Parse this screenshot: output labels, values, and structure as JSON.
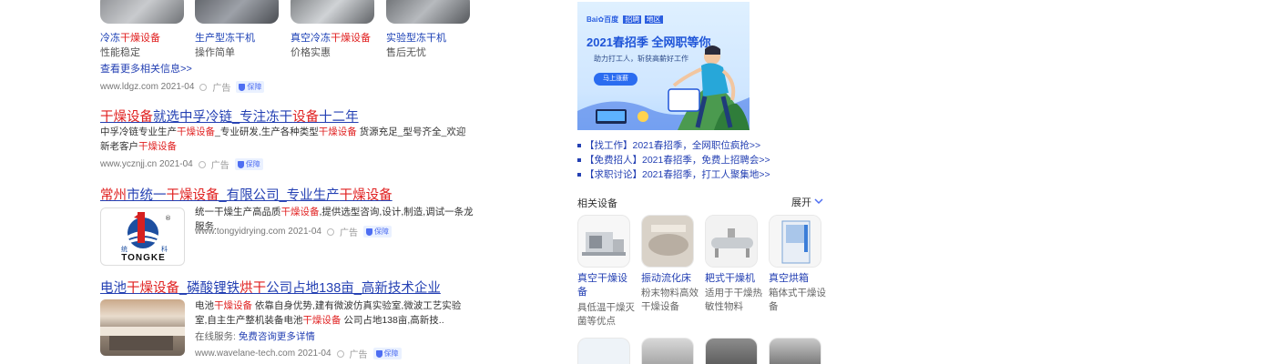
{
  "top_cards": [
    {
      "label_pre": "冷冻",
      "label_hl": "干燥设备",
      "sub": "性能稳定"
    },
    {
      "label_pre": "生产型冻干机",
      "label_hl": "",
      "sub": "操作简单"
    },
    {
      "label_pre": "真空冷冻",
      "label_hl": "干燥设备",
      "sub": "价格实惠"
    },
    {
      "label_pre": "实验型冻干机",
      "label_hl": "",
      "sub": "售后无忧"
    }
  ],
  "more_link": "查看更多相关信息>>",
  "result1_meta": {
    "url": "www.ldgz.com 2021-04",
    "ad": "广告",
    "badge": "保障"
  },
  "result2": {
    "title": [
      "干燥设备",
      "就选中孚冷链_专注冻干",
      "设备",
      "十二年"
    ],
    "desc": [
      "中孚冷链专业生产",
      "干燥设备",
      "_专业研发,生产各种类型",
      "干燥设备",
      " 货源充足_型号齐全_欢迎新老客户",
      "干燥设备"
    ],
    "url": "www.ycznjj.cn 2021-04",
    "ad": "广告",
    "badge": "保障"
  },
  "result3": {
    "title": [
      "常州",
      "市统一",
      "干燥设备",
      "_有限公司_专业生产",
      "干燥设备"
    ],
    "logo_top": "统",
    "logo_side": "科",
    "logo_text": "TONGKE",
    "desc": [
      "统一干燥生产高品质",
      "干燥设备",
      ",提供选型咨询,设计,制造,调试一条龙服务."
    ],
    "url": "www.tongyidrying.com 2021-04",
    "ad": "广告",
    "badge": "保障"
  },
  "result4": {
    "title": [
      "电池",
      "干燥设备",
      "_磷酸锂铁",
      "烘干",
      "公司占地138亩_高新技术企业"
    ],
    "desc": [
      "电池",
      "干燥设备",
      " 依靠自身优势,建有微波仿真实验室,微波工艺实验室,自主生产整机装备电池",
      "干燥设备",
      " 公司占地138亩,高新技.."
    ],
    "service_label": "在线服务:",
    "service_link": "免费咨询更多详情",
    "url": "www.wavelane-tech.com 2021-04",
    "ad": "广告",
    "badge": "保障"
  },
  "banner": {
    "brand": "Bai",
    "brand2": "百度",
    "tag1": "招聘",
    "tag2": "地区",
    "headline": "2021春招季 全网职等你",
    "subline": "助力打工人，斩获高薪好工作",
    "button": "马上涨薪"
  },
  "right_links": [
    "【找工作】2021春招季，全网职位疯抢>>",
    "【免费招人】2021春招季，免费上招聘会>>",
    "【求职讨论】2021春招季，打工人聚集地>>"
  ],
  "related": {
    "title": "相关设备",
    "expand": "展开",
    "items": [
      {
        "name": "真空干燥设备",
        "desc": "具低温干燥灭菌等优点"
      },
      {
        "name": "振动流化床",
        "desc": "粉末物料高效干燥设备"
      },
      {
        "name": "耙式干燥机",
        "desc": "适用于干燥热敏性物料"
      },
      {
        "name": "真空烘箱",
        "desc": "箱体式干燥设备"
      }
    ]
  },
  "colors": {
    "link": "#2440b3",
    "highlight": "#e02020",
    "banner_bg": "#d9ecff"
  }
}
